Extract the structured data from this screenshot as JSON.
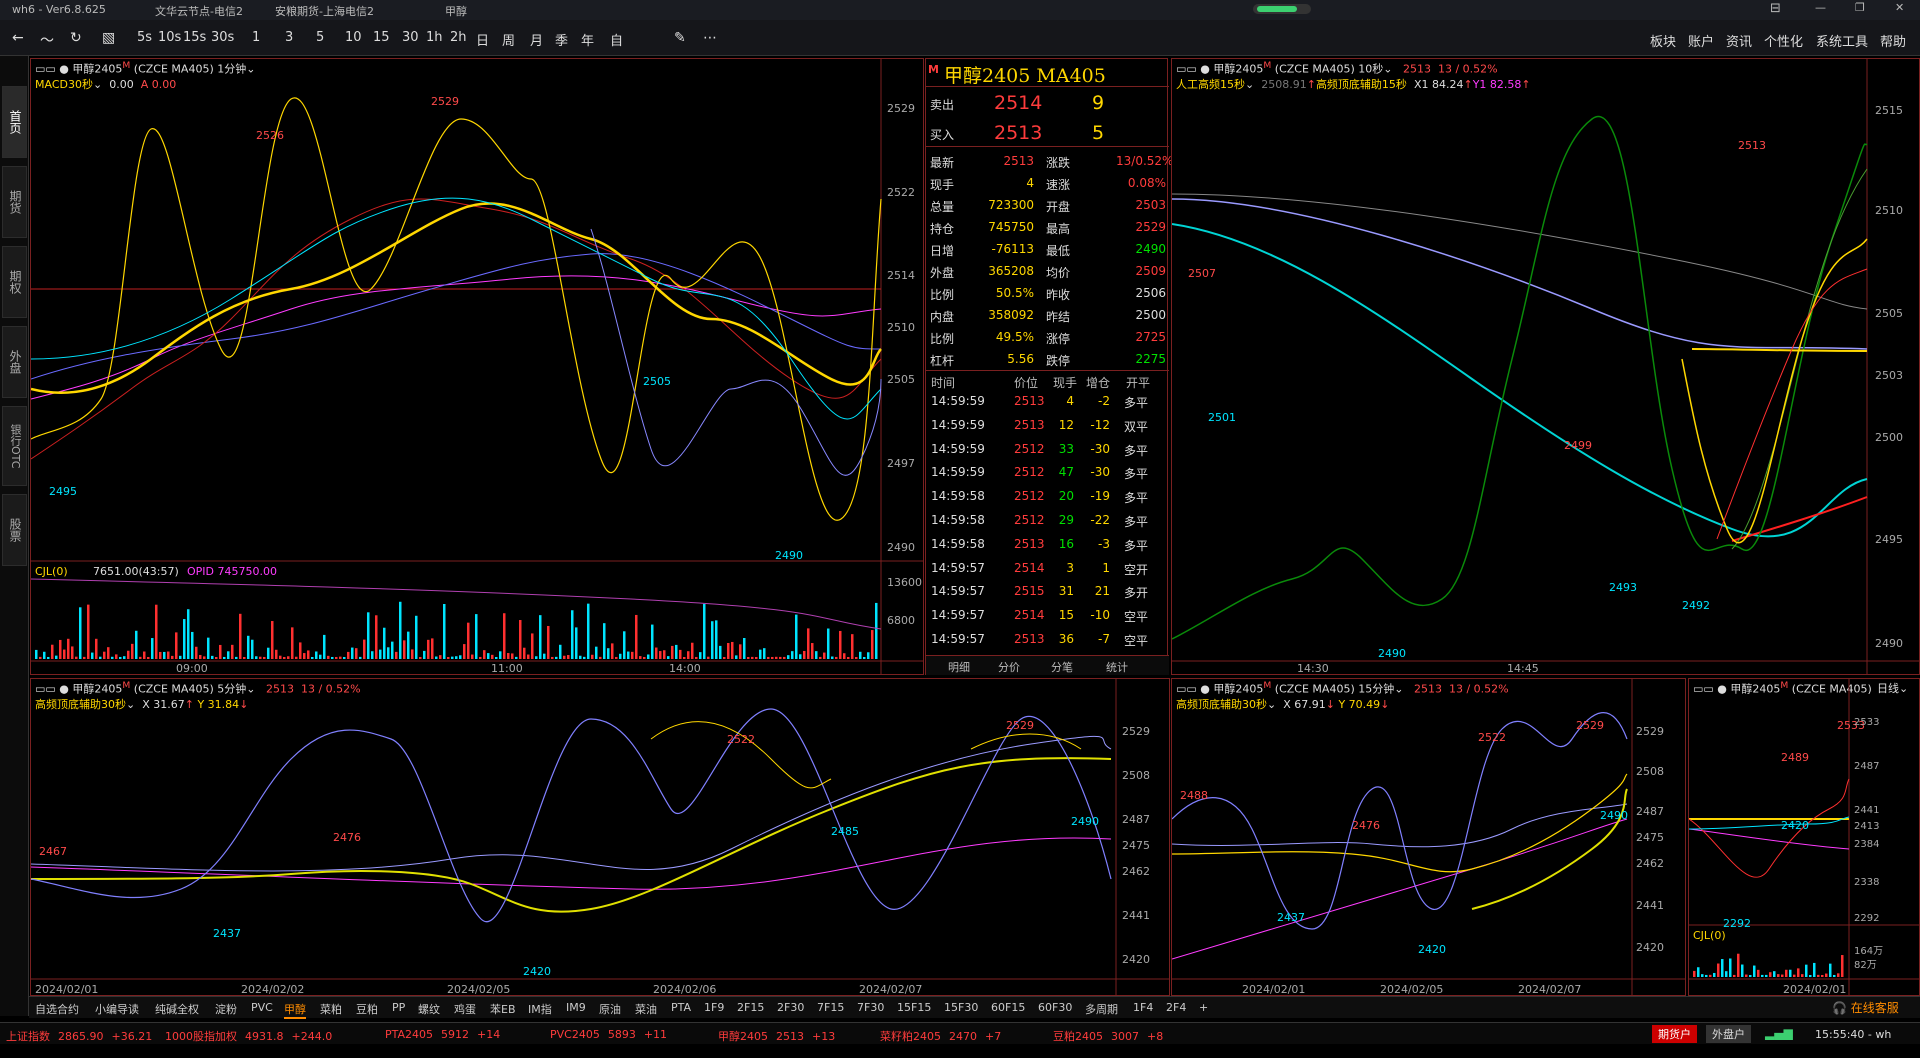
{
  "titlebar": {
    "version": "wh6 - Ver6.8.625",
    "server1": "文华云节点-电信2",
    "server2": "安粮期货-上海电信2",
    "title": "甲醇"
  },
  "toolbar": {
    "periods": [
      "5s",
      "10s",
      "15s",
      "30s",
      "1",
      "3",
      "5",
      "10",
      "15",
      "30",
      "1h",
      "2h",
      "日",
      "周",
      "月",
      "季",
      "年",
      "自"
    ],
    "menus": [
      "板块",
      "账户",
      "资讯",
      "个性化",
      "系统工具",
      "帮助"
    ]
  },
  "sidenav": [
    "首页",
    "期货",
    "期权",
    "外盘",
    "银行OTC",
    "股票"
  ],
  "panels": {
    "p1": {
      "head": "甲醇2405",
      "sup": "M",
      "code": "(CZCE MA405)",
      "period": "1分钟",
      "indicator": "MACD30秒",
      "ind_v1": "0.00",
      "ind_v2": "A 0.00",
      "yticks": [
        "2529",
        "2522",
        "2514",
        "2510",
        "2505",
        "2497",
        "2490"
      ],
      "xticks": [
        "09:00",
        "11:00",
        "14:00"
      ],
      "peaks": {
        "a": "2529",
        "b": "2526",
        "c": "2505",
        "d": "2495",
        "e": "2490"
      },
      "vol_label": "CJL(0)",
      "vol_val": "7651.00(43:57)",
      "opid": "OPID 745750.00",
      "vol_ticks": [
        "13600",
        "6800"
      ]
    },
    "p2": {
      "head": "甲醇2405",
      "sup": "M",
      "code": "(CZCE MA405)",
      "period": "10秒",
      "price": "2513",
      "change": "13 / 0.52%",
      "indicator": "人工高频15秒",
      "ind_v0": "2508.91",
      "ind_name2": "高频顶底辅助15秒",
      "ind_v1": "X1 84.24",
      "ind_v2": "Y1 82.58",
      "yticks": [
        "2515",
        "2510",
        "2505",
        "2503",
        "2500",
        "2495",
        "2490"
      ],
      "xticks": [
        "14:30",
        "14:45"
      ],
      "peaks": {
        "a": "2507",
        "b": "2501",
        "c": "2513",
        "d": "2499",
        "e": "2490",
        "f": "2493",
        "g": "2492"
      }
    },
    "p3": {
      "head": "甲醇2405",
      "sup": "M",
      "code": "(CZCE MA405)",
      "period": "5分钟",
      "price": "2513",
      "change": "13 / 0.52%",
      "indicator": "高频顶底辅助30秒",
      "ind_v1": "X 31.67",
      "ind_v2": "Y 31.84",
      "yticks": [
        "2529",
        "2508",
        "2487",
        "2475",
        "2462",
        "2441",
        "2420"
      ],
      "xticks": [
        "2024/02/01",
        "2024/02/02",
        "2024/02/05",
        "2024/02/06",
        "2024/02/07"
      ],
      "peaks": {
        "a": "2467",
        "b": "2476",
        "c": "2437",
        "d": "2420",
        "e": "2522",
        "f": "2485",
        "g": "2529",
        "h": "2490"
      }
    },
    "p4": {
      "head": "甲醇2405",
      "sup": "M",
      "code": "(CZCE MA405)",
      "period": "15分钟",
      "price": "2513",
      "change": "13 / 0.52%",
      "indicator": "高频顶底辅助30秒",
      "ind_v1": "X 67.91",
      "ind_v2": "Y 70.49",
      "yticks": [
        "2529",
        "2508",
        "2487",
        "2475",
        "2462",
        "2441",
        "2420"
      ],
      "xticks": [
        "2024/02/01",
        "2024/02/05",
        "2024/02/07"
      ],
      "peaks": {
        "a": "2488",
        "b": "2476",
        "c": "2437",
        "d": "2420",
        "e": "2522",
        "f": "2529",
        "g": "2490"
      }
    },
    "p5": {
      "head": "甲醇2405",
      "sup": "M",
      "code": "(CZCE MA405)",
      "period": "日线",
      "yticks": [
        "2533",
        "2487",
        "2441",
        "2413",
        "2384",
        "2338",
        "2292"
      ],
      "xticks": [
        "2024/02/01"
      ],
      "peaks": {
        "a": "2533",
        "b": "2489",
        "c": "2420",
        "d": "2292"
      },
      "vol_label": "CJL(0)",
      "vol_ticks": [
        "164万",
        "82万"
      ]
    }
  },
  "quote": {
    "title": "甲醇2405  MA405",
    "sell_label": "卖出",
    "sell_price": "2514",
    "sell_vol": "9",
    "buy_label": "买入",
    "buy_price": "2513",
    "buy_vol": "5",
    "stats": [
      [
        "最新",
        "2513",
        "涨跌",
        "13/0.52%"
      ],
      [
        "现手",
        "4",
        "速涨",
        "0.08%"
      ],
      [
        "总量",
        "723300",
        "开盘",
        "2503"
      ],
      [
        "持仓",
        "745750",
        "最高",
        "2529"
      ],
      [
        "日增",
        "-76113",
        "最低",
        "2490"
      ],
      [
        "外盘",
        "365208",
        "均价",
        "2509"
      ],
      [
        "比例",
        "50.5%",
        "昨收",
        "2506"
      ],
      [
        "内盘",
        "358092",
        "昨结",
        "2500"
      ],
      [
        "比例",
        "49.5%",
        "涨停",
        "2725"
      ],
      [
        "杠杆",
        "5.56",
        "跌停",
        "2275"
      ]
    ],
    "tick_headers": [
      "时间",
      "价位",
      "现手",
      "增仓",
      "开平"
    ],
    "ticks": [
      [
        "14:59:59",
        "2513",
        "4",
        "-2",
        "多平"
      ],
      [
        "14:59:59",
        "2513",
        "12",
        "-12",
        "双平"
      ],
      [
        "14:59:59",
        "2512",
        "33",
        "-30",
        "多平"
      ],
      [
        "14:59:59",
        "2512",
        "47",
        "-30",
        "多平"
      ],
      [
        "14:59:58",
        "2512",
        "20",
        "-19",
        "多平"
      ],
      [
        "14:59:58",
        "2512",
        "29",
        "-22",
        "多平"
      ],
      [
        "14:59:58",
        "2513",
        "16",
        "-3",
        "多平"
      ],
      [
        "14:59:57",
        "2514",
        "3",
        "1",
        "空开"
      ],
      [
        "14:59:57",
        "2515",
        "31",
        "21",
        "多开"
      ],
      [
        "14:59:57",
        "2514",
        "15",
        "-10",
        "空平"
      ],
      [
        "14:59:57",
        "2513",
        "36",
        "-7",
        "空平"
      ]
    ],
    "tabs": [
      "明细",
      "分价",
      "分笔",
      "统计"
    ]
  },
  "bottom_tabs": [
    "自选合约",
    "小编导读",
    "纯碱全权",
    "淀粉",
    "PVC",
    "甲醇",
    "菜粕",
    "豆粕",
    "PP",
    "螺纹",
    "鸡蛋",
    "苯EB",
    "IM指",
    "IM9",
    "原油",
    "菜油",
    "PTA",
    "1F9",
    "2F15",
    "2F30",
    "7F15",
    "7F30",
    "15F15",
    "15F30",
    "60F15",
    "60F30",
    "多周期",
    "1F4",
    "2F4"
  ],
  "online_service": "在线客服",
  "status": [
    {
      "name": "上证指数",
      "price": "2865.90",
      "chg": "+36.21"
    },
    {
      "name": "1000股指加权",
      "price": "4931.8",
      "chg": "+244.0"
    },
    {
      "name": "PTA2405",
      "price": "5912",
      "chg": "+14"
    },
    {
      "name": "PVC2405",
      "price": "5893",
      "chg": "+11"
    },
    {
      "name": "甲醇2405",
      "price": "2513",
      "chg": "+13"
    },
    {
      "name": "菜籽粕2405",
      "price": "2470",
      "chg": "+7"
    },
    {
      "name": "豆粕2405",
      "price": "3007",
      "chg": "+8"
    }
  ],
  "status_right": {
    "acct": "期货户",
    "outer": "外盘户",
    "time": "15:55:40 - wh"
  }
}
